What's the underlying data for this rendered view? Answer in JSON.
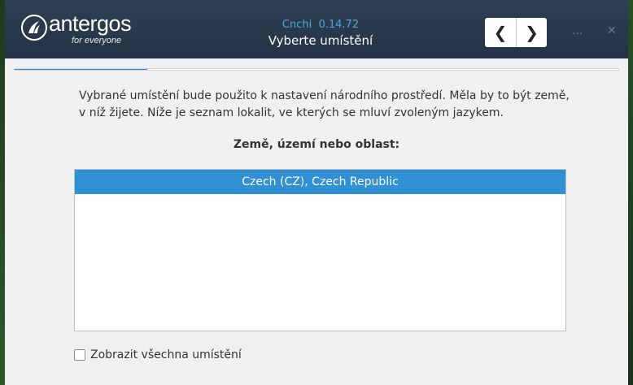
{
  "header": {
    "logo_word": "antergos",
    "logo_tagline": "for everyone",
    "app_name": "Cnchi  0.14.72",
    "page_title": "Vyberte umístění",
    "back_glyph": "❮",
    "forward_glyph": "❯",
    "minimize_glyph": "...",
    "close_glyph": "✕"
  },
  "progress": {
    "fraction": 0.22
  },
  "content": {
    "description": "Vybrané umístění bude použito k nastavení národního prostředí. Měla by to být země, v níž žijete. Níže je seznam lokalit, ve kterých se mluví zvoleným jazykem.",
    "list_heading": "Země, území nebo oblast:",
    "locations": [
      {
        "label": "Czech (CZ), Czech Republic",
        "selected": true
      }
    ],
    "show_all_label": "Zobrazit všechna umístění",
    "show_all_checked": false
  },
  "colors": {
    "accent": "#3190d4",
    "titlebar": "#2a3a4d",
    "app_name": "#4aa6e0"
  }
}
